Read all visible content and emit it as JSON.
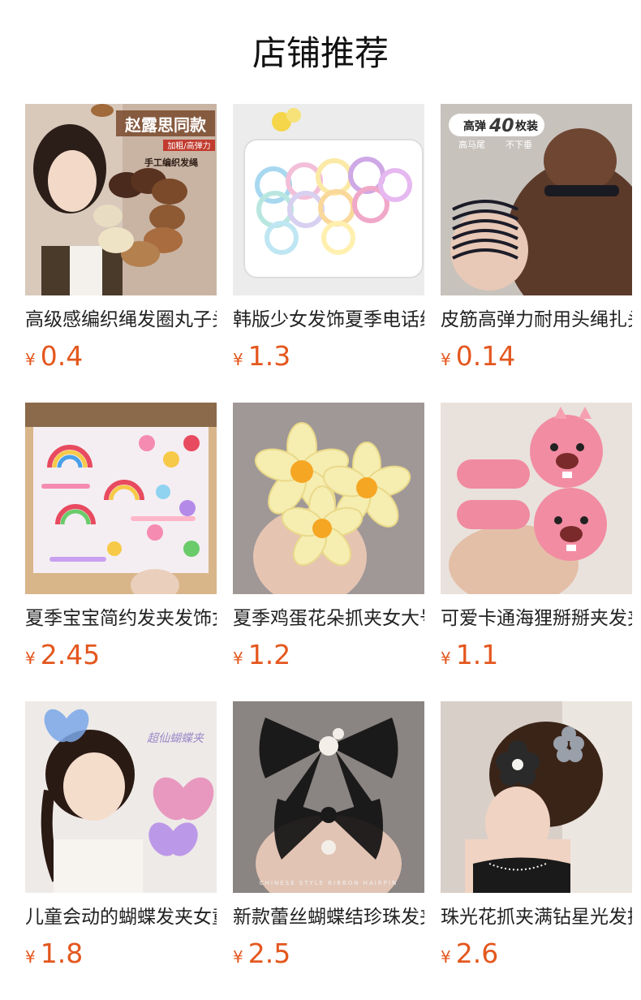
{
  "section": {
    "title": "店铺推荐"
  },
  "currency": "¥",
  "products": [
    {
      "name": "高级感编织绳发圈丸子头发绳",
      "price": "0.4",
      "image": {
        "overlay_title": "赵露思同款",
        "overlay_tag": "加粗/高弹力",
        "overlay_sub": "手工编织发绳"
      }
    },
    {
      "name": "韩版少女发饰夏季电话线发圈",
      "price": "1.3",
      "image": {}
    },
    {
      "name": "皮筋高弹力耐用头绳扎头发",
      "price": "0.14",
      "image": {
        "overlay_title_a": "高弹",
        "overlay_number": "40",
        "overlay_title_b": "枚装",
        "overlay_sub_a": "高马尾",
        "overlay_sub_b": "不下垂"
      }
    },
    {
      "name": "夏季宝宝简约发夹发饰女童",
      "price": "2.45",
      "image": {}
    },
    {
      "name": "夏季鸡蛋花朵抓夹女大号",
      "price": "1.2",
      "image": {}
    },
    {
      "name": "可爱卡通海狸掰掰夹发夹",
      "price": "1.1",
      "image": {}
    },
    {
      "name": "儿童会动的蝴蝶发夹女童",
      "price": "1.8",
      "image": {
        "overlay_text": "超仙蝴蝶夹"
      }
    },
    {
      "name": "新款蕾丝蝴蝶结珍珠发夹",
      "price": "2.5",
      "image": {
        "overlay_caption": "CHINESE STYLE RIBBON HAIRPIN"
      }
    },
    {
      "name": "珠光花抓夹满钻星光发抓",
      "price": "2.6",
      "image": {}
    }
  ],
  "colors": {
    "price": "#e4571e",
    "title": "#111111",
    "name": "#222222"
  }
}
